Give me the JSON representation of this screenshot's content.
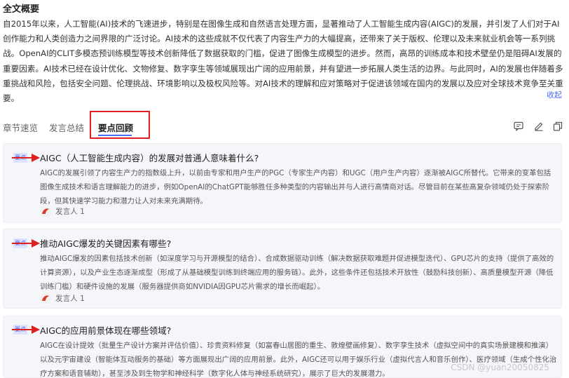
{
  "summary": {
    "title": "全文概要",
    "text": "自2015年以来，人工智能(AI)技术的飞速进步，特别是在图像生成和自然语言处理方面，显著推动了人工智能生成内容(AIGC)的发展，并引发了人们对于AI创作能力和人类创造力之间界限的广泛讨论。AI技术的这些成就不仅代表了内容生产力的大幅提高，还带来了关于版权、伦理以及未来就业机会等一系列挑战。OpenAI的CLIT多模态预训练模型等技术创新降低了数据获取的门槛，促进了图像生成模型的进步。然而，高昂的训练成本和技术壁垒仍是阻碍AI发展的重要因素。AI技术已经在设计优化、文物修复、数字孪生等领域展现出广阔的应用前景，并有望进一步拓展人类生活的边界。与此同时，AI的发展也伴随着多重挑战和风险，包括安全问题、伦理挑战、环境影响以及极权风险等。对AI技术的理解和应对策略对于促进该领域在国内的发展以及应对全球技术竞争至关重要。",
    "collapse_label": "收起"
  },
  "tabs": [
    {
      "label": "章节速览"
    },
    {
      "label": "发言总结"
    },
    {
      "label": "要点回顾"
    }
  ],
  "toolbar": {
    "icons": [
      "comment-icon",
      "edit-icon",
      "copy-icon"
    ]
  },
  "cards": [
    {
      "tag": "要点",
      "title": "AIGC（人工智能生成内容）的发展对普通人意味着什么?",
      "body": "AIGC的发展引领了内容生产力的指数级上升，以前由专家和用户生产的PGC（专家生产内容）和UGC（用户生产内容）逐渐被AIGC所替代。它带来的变革包括图像生成技术和语言理解能力的进步，例如OpenAI的ChatGPT能够胜任多种类型的内容输出并与人进行高情商对话。尽管目前在某些高复杂领域仍处于探索阶段，但其快速学习能力和潜力让人对未来充满期待。",
      "speaker": "发言人 1"
    },
    {
      "tag": "要点",
      "title": "推动AIGC爆发的关键因素有哪些?",
      "body": "推动AIGC爆发的因素包括技术创新（如深度学习与开源模型的结合）、合成数据驱动训练（解决数据获取难题并促进模型迭代）、GPU芯片的支持（提供了高效的计算资源），以及产业生态逐渐成型（形成了从基础模型训练到终端应用的服务链）。此外，这些条件还包括技术开放性（鼓励科技创新）、高质量模型开源（降低训练门槛）和硬件设施的发展（服务器提供商如NVIDIA因GPU芯片需求的增长而崛起）。",
      "speaker": "发言人 1"
    },
    {
      "tag": "要点",
      "title": "AIGC的应用前景体现在哪些领域?",
      "body": "AIGC在设计提效（批量生产设计方案并评估价值）、珍贵资料修复（如富春山居图的重生、敦煌壁画修复）、数字孪生技术（虚拟空间中的真实场景建模和推演）以及元宇宙建设（智能体互动服务的基础）等方面展现出广阔的应用前景。此外，AIGC还可以用于娱乐行业（虚拟代言人和音乐创作）、医疗领域（生成个性化治疗方案和语音辅助），甚至涉及到生物学和神经科学（数字化人体与神经系统研究），展示了巨大的发展潜力。",
      "speaker": ""
    }
  ],
  "watermark": "CSDN @yuan20050825"
}
